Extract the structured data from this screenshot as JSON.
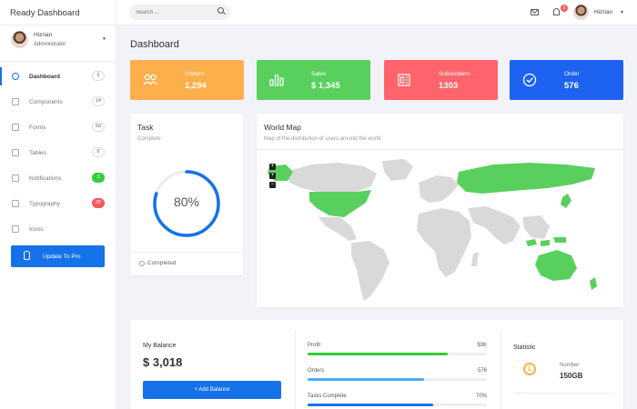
{
  "app": {
    "title": "Ready Dashboard"
  },
  "search": {
    "placeholder": "Search ..."
  },
  "header": {
    "notification_count": "5",
    "user_name": "Hizrian"
  },
  "profile": {
    "name": "Hizrian",
    "role": "Administrator"
  },
  "sidebar": {
    "items": [
      {
        "label": "Dashboard",
        "badge": "5",
        "icon": "dashboard-icon",
        "active": true
      },
      {
        "label": "Components",
        "badge": "14",
        "icon": "components-icon"
      },
      {
        "label": "Forms",
        "badge": "50",
        "icon": "forms-icon"
      },
      {
        "label": "Tables",
        "badge": "6",
        "icon": "tables-icon"
      },
      {
        "label": "Notifications",
        "badge": "3",
        "icon": "bell-icon"
      },
      {
        "label": "Typography",
        "badge": "25",
        "icon": "typography-icon"
      },
      {
        "label": "Icons",
        "badge": "",
        "icon": "icons-icon"
      }
    ],
    "update_label": "Update To Pro"
  },
  "page": {
    "title": "Dashboard"
  },
  "stats": [
    {
      "label": "Visitors",
      "value": "1,294",
      "color": "#fdaf4b",
      "icon": "users-icon"
    },
    {
      "label": "Sales",
      "value": "$ 1,345",
      "color": "#59d05d",
      "icon": "bar-chart-icon"
    },
    {
      "label": "Subscribers",
      "value": "1303",
      "color": "#ff646d",
      "icon": "newspaper-icon"
    },
    {
      "label": "Order",
      "value": "576",
      "color": "#1d62f0",
      "icon": "check-circle-icon"
    }
  ],
  "task": {
    "title": "Task",
    "subtitle": "Complete",
    "percent": 80,
    "percent_label": "80%",
    "footer": "Completed"
  },
  "map": {
    "title": "World Map",
    "subtitle": "Map of the distribution of users around the world",
    "highlight_color": "#59d05d"
  },
  "balance": {
    "label": "My Balance",
    "value": "$ 3,018",
    "button": "+ Add Balance"
  },
  "progress": [
    {
      "label": "Profit",
      "value": "$3K",
      "percent": 78,
      "color": "#31ce36"
    },
    {
      "label": "Orders",
      "value": "576",
      "percent": 65,
      "color": "#48abf7"
    },
    {
      "label": "Tasks Complete",
      "value": "70%",
      "percent": 70,
      "color": "#1572e8"
    }
  ],
  "statistic": {
    "title": "Statistic",
    "label": "Number",
    "value": "150GB"
  }
}
